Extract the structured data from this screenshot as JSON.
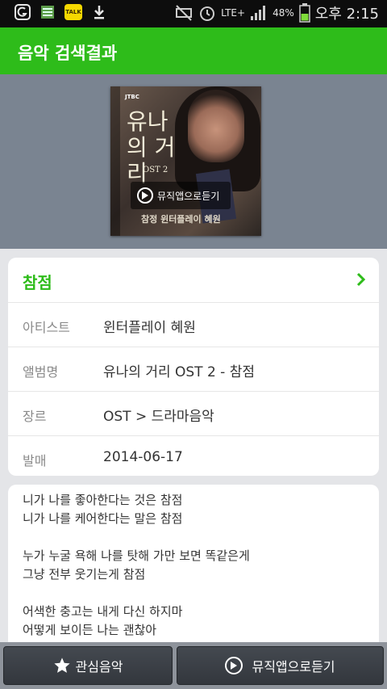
{
  "status_bar": {
    "network": "LTE+",
    "battery": "48%",
    "time": "오후 2:15",
    "icons": [
      "app-icon",
      "list-app-icon",
      "kakaotalk-icon",
      "download-icon",
      "mute-icon",
      "alarm-icon",
      "signal-icon",
      "battery-icon"
    ],
    "kakao_label": "TALK"
  },
  "header": {
    "title": "음악 검색결과"
  },
  "album": {
    "cover_network": "JTBC",
    "cover_title": "유나의 거리",
    "cover_subtitle": "OST 2",
    "cover_credit": "참정  윈터플레이 혜원",
    "listen_button": "뮤직앱으로듣기"
  },
  "song": {
    "title": "참점",
    "details": [
      {
        "label": "아티스트",
        "value": "윈터플레이 혜원"
      },
      {
        "label": "앨범명",
        "value": "유나의 거리 OST 2 - 참점"
      },
      {
        "label": "장르",
        "value": "OST > 드라마음악"
      },
      {
        "label": "발매",
        "value": "2014-06-17"
      }
    ]
  },
  "lyrics": {
    "lines": [
      "니가 나를 좋아한다는 것은 참점",
      "니가 나를 케어한다는 말은 참점",
      "",
      "누가 누굴 욕해 나를 탓해 가만 보면 똑같은게",
      "그냥 전부 웃기는게 참점",
      "",
      "어색한 충고는 내게 다신 하지마",
      "어떻게 보이든 나는 괜찮아"
    ]
  },
  "bottom_bar": {
    "favorite_label": "관심음악",
    "listen_label": "뮤직앱으로듣기"
  },
  "colors": {
    "accent": "#2ebc1a",
    "album_bg": "#7a8491",
    "page_bg": "#e4e5e8"
  }
}
